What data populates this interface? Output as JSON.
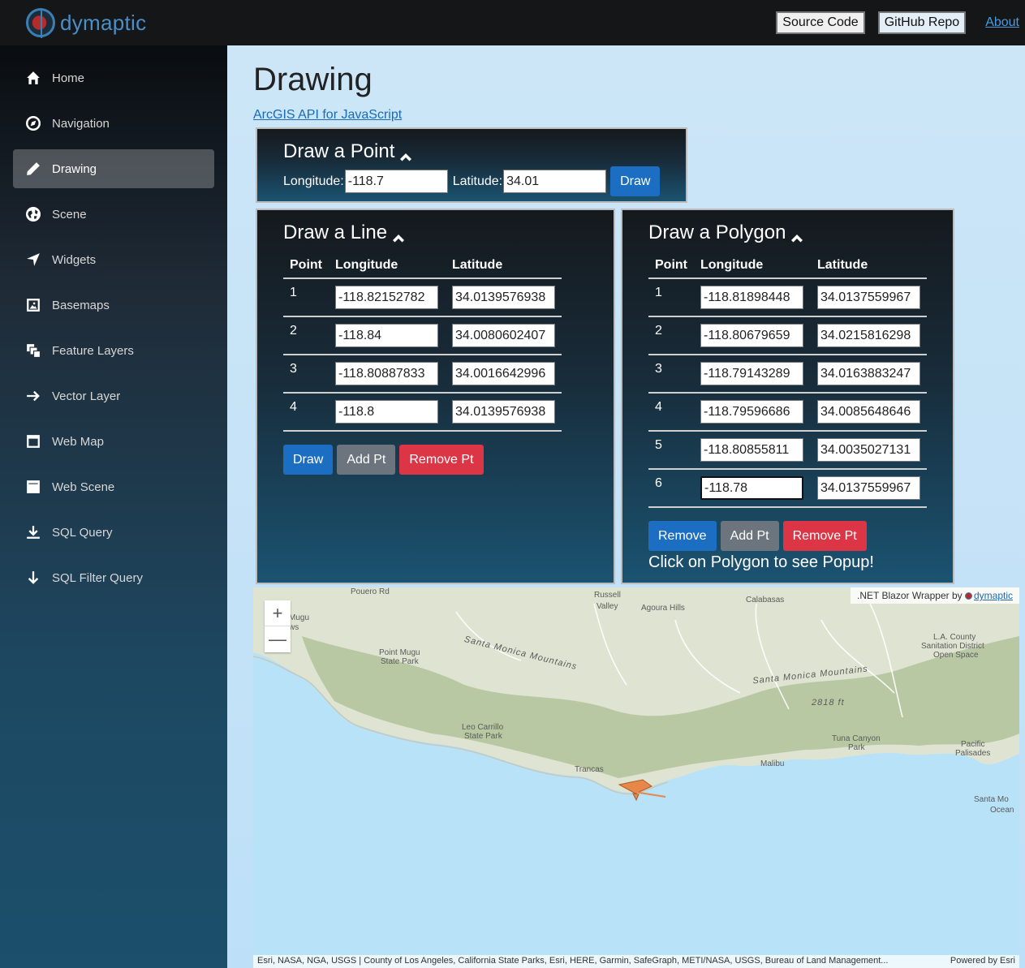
{
  "brand": {
    "name": "dymaptic"
  },
  "topbar": {
    "source_code": "Source Code",
    "github_repo": "GitHub Repo",
    "about": "About"
  },
  "sidebar": {
    "items": [
      {
        "label": "Home",
        "icon": "home-icon"
      },
      {
        "label": "Navigation",
        "icon": "compass-icon"
      },
      {
        "label": "Drawing",
        "icon": "pencil-icon",
        "active": true
      },
      {
        "label": "Scene",
        "icon": "globe-icon"
      },
      {
        "label": "Widgets",
        "icon": "location-arrow-icon"
      },
      {
        "label": "Basemaps",
        "icon": "image-icon"
      },
      {
        "label": "Feature Layers",
        "icon": "layers-icon"
      },
      {
        "label": "Vector Layer",
        "icon": "arrow-right-icon"
      },
      {
        "label": "Web Map",
        "icon": "browser-icon"
      },
      {
        "label": "Web Scene",
        "icon": "browser-filled-icon"
      },
      {
        "label": "SQL Query",
        "icon": "download-icon"
      },
      {
        "label": "SQL Filter Query",
        "icon": "arrow-down-icon"
      }
    ]
  },
  "main": {
    "title": "Drawing",
    "api_link": "ArcGIS API for JavaScript"
  },
  "point_panel": {
    "title": "Draw a Point",
    "longitude_label": "Longitude:",
    "longitude_value": "-118.7",
    "latitude_label": "Latitude:",
    "latitude_value": "34.01",
    "draw_button": "Draw"
  },
  "line_panel": {
    "title": "Draw a Line",
    "headers": [
      "Point",
      "Longitude",
      "Latitude"
    ],
    "rows": [
      {
        "point": "1",
        "longitude": "-118.82152782",
        "latitude": "34.0139576938"
      },
      {
        "point": "2",
        "longitude": "-118.84",
        "latitude": "34.0080602407"
      },
      {
        "point": "3",
        "longitude": "-118.80887833",
        "latitude": "34.0016642996"
      },
      {
        "point": "4",
        "longitude": "-118.8",
        "latitude": "34.0139576938"
      }
    ],
    "draw_button": "Draw",
    "add_button": "Add Pt",
    "remove_button": "Remove Pt"
  },
  "polygon_panel": {
    "title": "Draw a Polygon",
    "headers": [
      "Point",
      "Longitude",
      "Latitude"
    ],
    "rows": [
      {
        "point": "1",
        "longitude": "-118.81898448",
        "latitude": "34.0137559967"
      },
      {
        "point": "2",
        "longitude": "-118.80679659",
        "latitude": "34.0215816298"
      },
      {
        "point": "3",
        "longitude": "-118.79143289",
        "latitude": "34.0163883247"
      },
      {
        "point": "4",
        "longitude": "-118.79596686",
        "latitude": "34.0085648646"
      },
      {
        "point": "5",
        "longitude": "-118.80855811",
        "latitude": "34.0035027131"
      },
      {
        "point": "6",
        "longitude": "-118.78",
        "latitude": "34.0137559967"
      }
    ],
    "remove_button": "Remove",
    "add_button": "Add Pt",
    "remove_pt_button": "Remove Pt",
    "popup_hint": "Click on Polygon to see Popup!"
  },
  "map": {
    "credit_prefix": ".NET Blazor Wrapper by ",
    "credit_link": "dymaptic",
    "zoom_in": "+",
    "zoom_out": "—",
    "attribution": "Esri, NASA, NGA, USGS | County of Los Angeles, California State Parks, Esri, HERE, Garmin, SafeGraph, METI/NASA, USGS, Bureau of Land Management...",
    "powered_by": "Powered by Esri",
    "labels": {
      "pouero": "Pouero Rd",
      "russell": "Russell",
      "valley": "Valley",
      "agoura": "Agoura Hills",
      "calabasas": "Calabasas",
      "mugu": "Mugu",
      "ws": "ws",
      "pmsp1": "Point Mugu",
      "pmsp2": "State Park",
      "smm1": "Santa Monica Mountains",
      "smm2": "Santa Monica Mountains",
      "la1": "L.A. County",
      "la2": "Sanitation District",
      "la3": "Open Space",
      "elev": "2818 ft",
      "leo1": "Leo Carrillo",
      "leo2": "State Park",
      "tuna1": "Tuna Canyon",
      "tuna2": "Park",
      "pp1": "Pacific",
      "pp2": "Palisades",
      "trancas": "Trancas",
      "malibu": "Malibu",
      "santamo": "Santa Mo",
      "ocean": "Ocean"
    },
    "colors": {
      "water": "#b7e2f8",
      "land": "#dfe3d1",
      "polygon": "#e8874a"
    }
  }
}
